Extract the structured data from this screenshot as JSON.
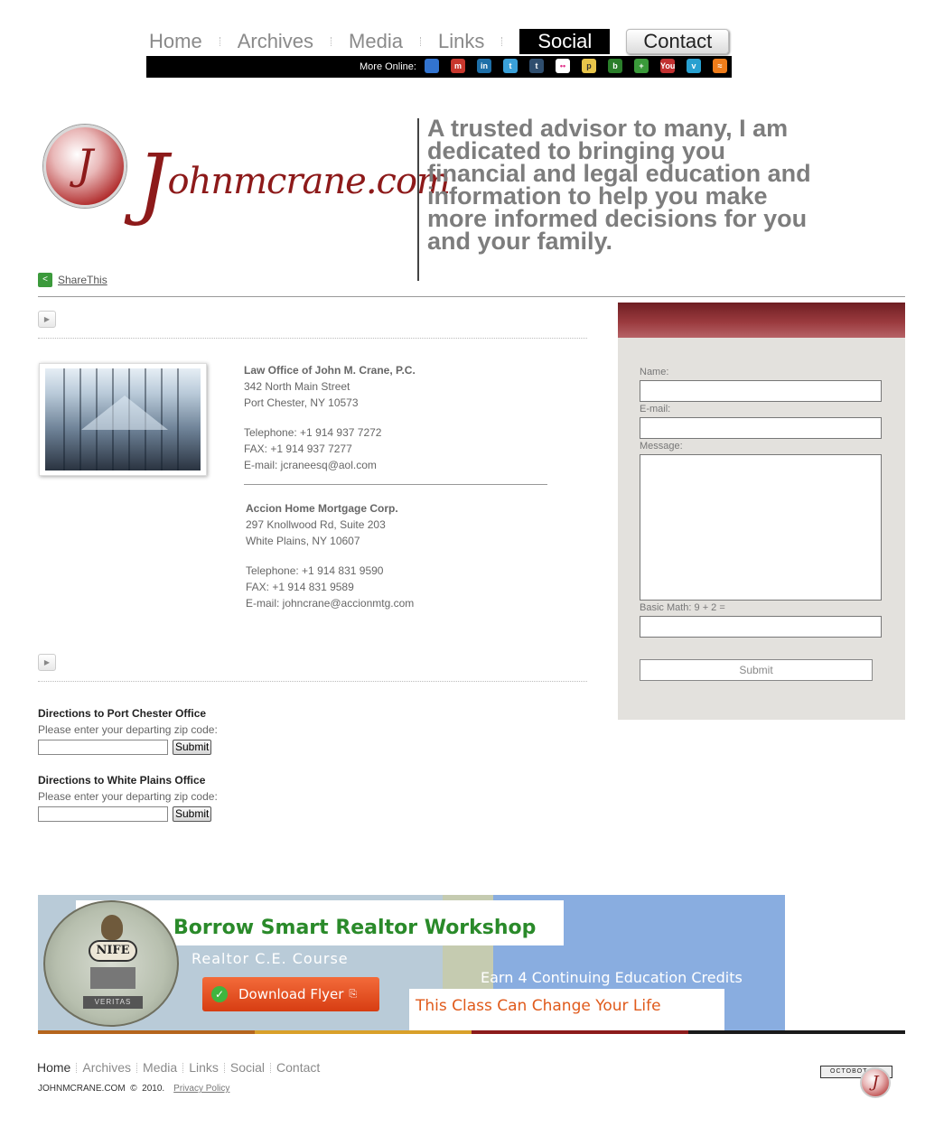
{
  "nav": {
    "home": "Home",
    "archives": "Archives",
    "media": "Media",
    "links": "Links",
    "social": "Social",
    "contact": "Contact"
  },
  "more_online": {
    "label": "More Online:",
    "icons": [
      "delicious-icon",
      "mixx-icon",
      "linkedin-icon",
      "twitter-icon",
      "tumblr-icon",
      "flickr-icon",
      "posterous-icon",
      "blogger-icon",
      "addthis-icon",
      "youtube-icon",
      "vimeo-icon",
      "rss-icon"
    ],
    "icon_glyphs": [
      "",
      "m",
      "in",
      "t",
      "t",
      "••",
      "p",
      "b",
      "+",
      "You",
      "v",
      "≈"
    ],
    "icon_colors": [
      "#3274d0",
      "#c8372d",
      "#1e6fa8",
      "#3aa0d8",
      "#2f4e6e",
      "#ffffff",
      "#e8c54a",
      "#2a7e2a",
      "#3a9a3a",
      "#c23030",
      "#28a0d0",
      "#f07d1a"
    ]
  },
  "logo": {
    "monogram": "J",
    "wordmark_initial": "J",
    "wordmark_rest": "ohnmcrane.com"
  },
  "share": {
    "label": "ShareThis"
  },
  "tagline": "A trusted advisor to many, I am dedicated to bringing you financial and legal education and information to help you make more informed decisions for you and your family.",
  "offices": [
    {
      "name": "Law Office of John M. Crane, P.C.",
      "street": "342 North Main Street",
      "city": "Port Chester, NY 10573",
      "telephone": "Telephone: +1 914 937 7272",
      "fax": "FAX: +1 914 937 7277",
      "email": "E-mail: jcraneesq@aol.com"
    },
    {
      "name": "Accion Home Mortgage Corp.",
      "street": "297 Knollwood Rd, Suite 203",
      "city": "White Plains, NY 10607",
      "telephone": "Telephone: +1 914 831 9590",
      "fax": "FAX: +1 914 831 9589",
      "email": "E-mail: johncrane@accionmtg.com"
    }
  ],
  "directions": [
    {
      "title": "Directions to Port Chester Office",
      "prompt": "Please enter your departing zip code:",
      "zip_value": "",
      "submit": "Submit"
    },
    {
      "title": "Directions to White Plains Office",
      "prompt": "Please enter your departing zip code:",
      "zip_value": "",
      "submit": "Submit"
    }
  ],
  "contact_form": {
    "name_label": "Name:",
    "email_label": "E-mail:",
    "message_label": "Message:",
    "math_label": "Basic Math: 9 + 2 =",
    "submit": "Submit",
    "header_color": "#8a2e33",
    "panel_color": "#e3e1dd"
  },
  "banner": {
    "title": "Borrow Smart Realtor Workshop",
    "course": "Realtor C.E. Course",
    "download": "Download Flyer",
    "credits": "Earn 4 Continuing Education Credits",
    "tagline": "This Class Can Change Your Life",
    "seal_text": "NIFE",
    "seal_motto": "VERITAS",
    "stripe_colors": [
      "#b5651d",
      "#d9a02a",
      "#8c1b1b",
      "#1a1a1a"
    ]
  },
  "footer": {
    "links": [
      "Home",
      "Archives",
      "Media",
      "Links",
      "Social",
      "Contact"
    ],
    "copyright": "JOHNMCRANE.COM  ©  2010.",
    "privacy": "Privacy Policy",
    "badge": "OCTOBOT"
  }
}
